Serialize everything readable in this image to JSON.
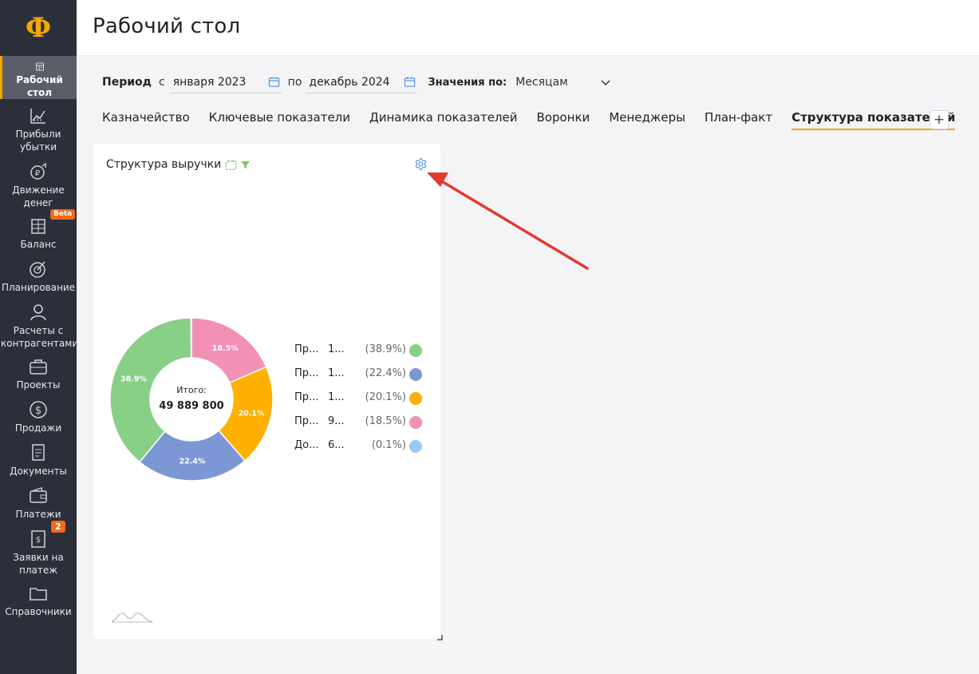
{
  "app": {
    "logo": "Ф"
  },
  "sidebar": {
    "items": [
      {
        "label": "Рабочий стол",
        "icon": "dashboard-icon",
        "active": true
      },
      {
        "label": "Прибыли убытки",
        "icon": "chart-icon"
      },
      {
        "label": "Движение денег",
        "icon": "money-flow-icon"
      },
      {
        "label": "Баланс",
        "icon": "balance-icon",
        "badge": "Beta"
      },
      {
        "label": "Планирование",
        "icon": "target-icon"
      },
      {
        "label": "Расчеты с контрагентами",
        "icon": "contractors-icon"
      },
      {
        "label": "Проекты",
        "icon": "briefcase-icon"
      },
      {
        "label": "Продажи",
        "icon": "dollar-icon"
      },
      {
        "label": "Документы",
        "icon": "documents-icon"
      },
      {
        "label": "Платежи",
        "icon": "wallet-icon"
      },
      {
        "label": "Заявки на платеж",
        "icon": "payment-request-icon",
        "badge": "2"
      },
      {
        "label": "Справочники",
        "icon": "folder-icon"
      }
    ]
  },
  "header": {
    "title": "Рабочий стол"
  },
  "filters": {
    "period_label": "Период",
    "from_label": "с",
    "from_value": "января 2023",
    "to_label": "по",
    "to_value": "декабрь 2024",
    "values_label": "Значения по:",
    "values_selected": "Месяцам"
  },
  "tabs": [
    {
      "label": "Казначейство"
    },
    {
      "label": "Ключевые показатели"
    },
    {
      "label": "Динамика показателей"
    },
    {
      "label": "Воронки"
    },
    {
      "label": "Менеджеры"
    },
    {
      "label": "План-факт"
    },
    {
      "label": "Структура показателей",
      "active": true
    }
  ],
  "tab_add_label": "+",
  "card": {
    "title": "Структура выручки",
    "center_label": "Итого:",
    "center_value": "49 889 800"
  },
  "colors": {
    "accent": "#f5a700",
    "sidebar_bg": "#2b2f3a",
    "icon_blue": "#4a90e2",
    "icon_green": "#7dc36b"
  },
  "chart_data": {
    "type": "pie",
    "donut": true,
    "title": "Структура выручки",
    "total_label": "Итого:",
    "total": "49 889 800",
    "legend_position": "right",
    "slices": [
      {
        "name": "Пр...",
        "value_label": "1...",
        "percent": 18.5,
        "color": "#f290b5",
        "legend_pct": "(18.5%)",
        "legend_name": "Пр...",
        "legend_value": "9..."
      },
      {
        "name": "Пр...",
        "value_label": "1...",
        "percent": 20.1,
        "color": "#ffb000",
        "legend_pct": "(20.1%)",
        "legend_name": "Пр...",
        "legend_value": "1..."
      },
      {
        "name": "Пр...",
        "value_label": "1...",
        "percent": 22.4,
        "color": "#7b97d4",
        "legend_pct": "(22.4%)",
        "legend_name": "Пр...",
        "legend_value": "1..."
      },
      {
        "name": "Пр...",
        "value_label": "1...",
        "percent": 38.9,
        "color": "#88cf87",
        "legend_pct": "(38.9%)",
        "legend_name": "Пр...",
        "legend_value": "1..."
      },
      {
        "name": "До...",
        "value_label": "6...",
        "percent": 0.1,
        "color": "#9ec9f6",
        "legend_pct": "(0.1%)",
        "legend_name": "До...",
        "legend_value": "6..."
      }
    ],
    "slice_labels": [
      "18.5%",
      "20.1%",
      "22.4%",
      "38.9%"
    ],
    "legend": [
      {
        "name": "Пр...",
        "value": "1...",
        "pct": "(38.9%)",
        "color": "#88cf87"
      },
      {
        "name": "Пр...",
        "value": "1...",
        "pct": "(22.4%)",
        "color": "#7b97d4"
      },
      {
        "name": "Пр...",
        "value": "1...",
        "pct": "(20.1%)",
        "color": "#ffb000"
      },
      {
        "name": "Пр...",
        "value": "9...",
        "pct": "(18.5%)",
        "color": "#f290b5"
      },
      {
        "name": "До...",
        "value": "6...",
        "pct": "(0.1%)",
        "color": "#9ec9f6"
      }
    ]
  }
}
